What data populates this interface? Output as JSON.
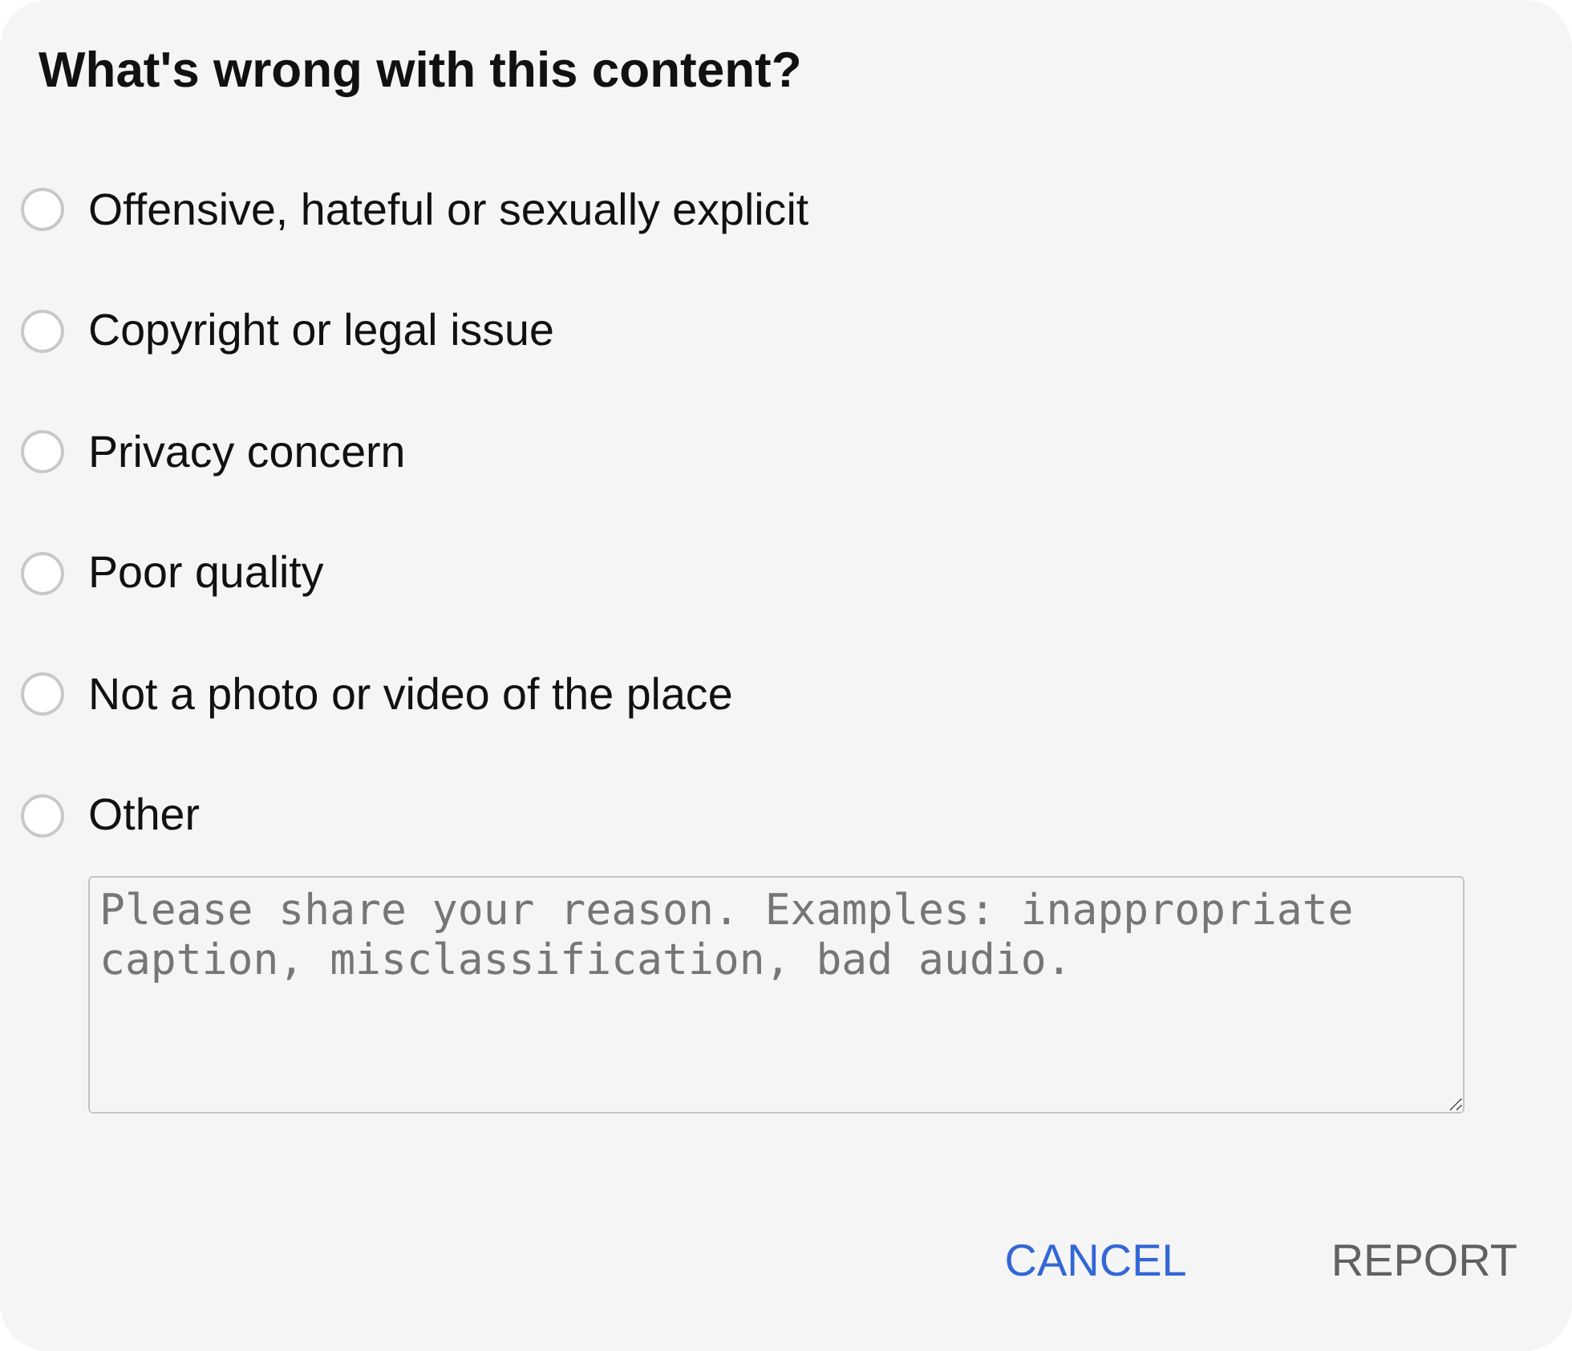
{
  "dialog": {
    "title": "What's wrong with this content?"
  },
  "options": [
    {
      "label": "Offensive, hateful or sexually explicit",
      "selected": false
    },
    {
      "label": "Copyright or legal issue",
      "selected": false
    },
    {
      "label": "Privacy concern",
      "selected": false
    },
    {
      "label": "Poor quality",
      "selected": false
    },
    {
      "label": "Not a photo or video of the place",
      "selected": false
    },
    {
      "label": "Other",
      "selected": false
    }
  ],
  "reason_field": {
    "placeholder": "Please share your reason. Examples: inappropriate caption, misclassification, bad audio."
  },
  "buttons": [
    {
      "label": "CANCEL",
      "disabled": false
    },
    {
      "label": "REPORT",
      "disabled": true
    }
  ]
}
